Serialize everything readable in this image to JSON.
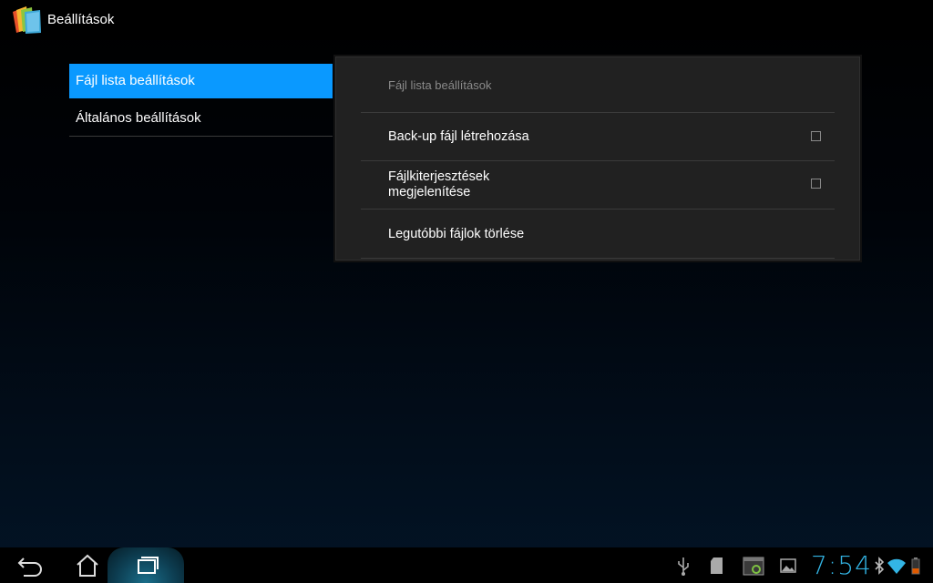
{
  "action_bar": {
    "title": "Beállítások",
    "app_icon": "notes-app-icon"
  },
  "headers": [
    {
      "label": "Fájl lista beállítások",
      "selected": true
    },
    {
      "label": "Általános beállítások",
      "selected": false
    }
  ],
  "panel": {
    "category": "Fájl lista beállítások",
    "prefs": [
      {
        "title": "Back-up fájl létrehozása",
        "checkbox": true,
        "checked": false
      },
      {
        "title_line1": "Fájlkiterjesztések",
        "title_line2": "megjelenítése",
        "checkbox": true,
        "checked": false
      },
      {
        "title": "Legutóbbi fájlok törlése",
        "checkbox": false
      }
    ]
  },
  "system_bar": {
    "time": "7:54",
    "icons": [
      "back-icon",
      "home-icon",
      "recent-apps-icon",
      "usb-icon",
      "sd-card-icon",
      "screenshot-icon",
      "gallery-icon",
      "bluetooth-icon",
      "wifi-icon",
      "battery-icon"
    ],
    "accent": "#33b5e5"
  },
  "colors": {
    "selected_header": "#0a99ff",
    "panel_bg": "#212121"
  }
}
